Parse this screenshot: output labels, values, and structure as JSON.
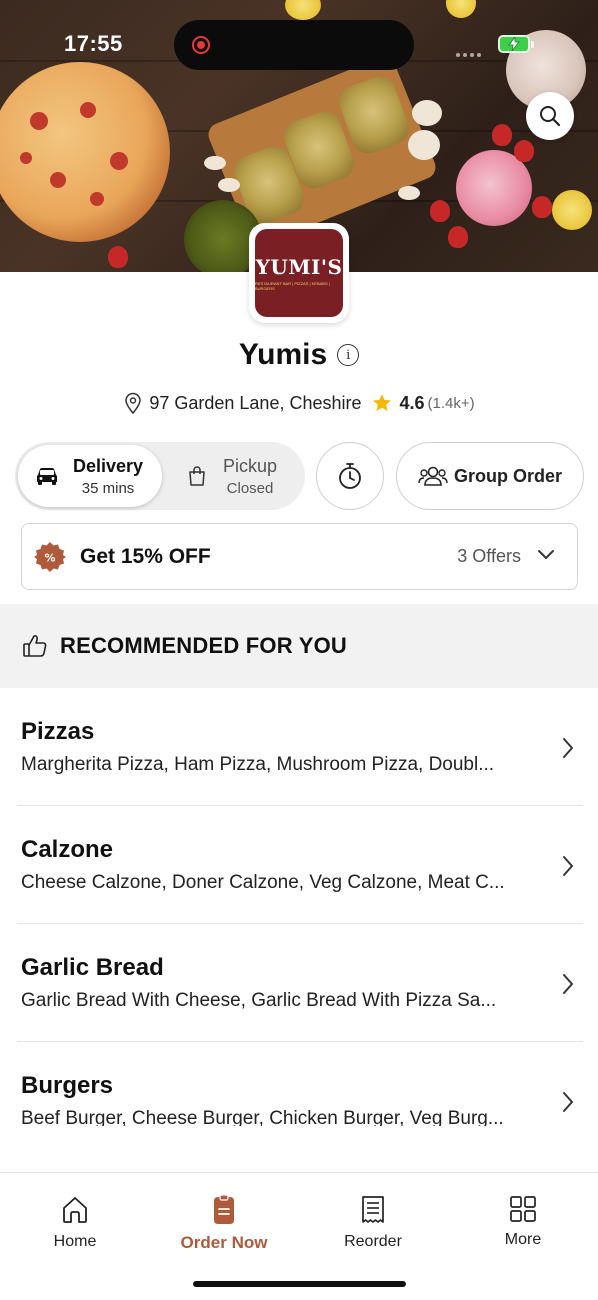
{
  "status_bar": {
    "time": "17:55"
  },
  "restaurant": {
    "logo_text": "YUMI'S",
    "logo_subtext": "RESTAURANT BAR | PIZZAS | KEBABS | BURGERS",
    "name": "Yumis",
    "address": "97 Garden Lane, Cheshire",
    "rating": "4.6",
    "rating_count": "(1.4k+)"
  },
  "order_mode": {
    "delivery": {
      "label": "Delivery",
      "sub": "35 mins",
      "selected": true
    },
    "pickup": {
      "label": "Pickup",
      "sub": "Closed",
      "selected": false
    },
    "group_order_label": "Group Order"
  },
  "offers": {
    "title": "Get 15% OFF",
    "count_label": "3 Offers",
    "badge_symbol": "%"
  },
  "recommended": {
    "title": "RECOMMENDED FOR YOU"
  },
  "categories": [
    {
      "name": "Pizzas",
      "items": "Margherita Pizza, Ham Pizza, Mushroom Pizza, Doubl..."
    },
    {
      "name": "Calzone",
      "items": "Cheese Calzone, Doner Calzone, Veg Calzone, Meat C..."
    },
    {
      "name": "Garlic Bread",
      "items": "Garlic Bread With Cheese, Garlic Bread With Pizza Sa..."
    },
    {
      "name": "Burgers",
      "items": "Beef Burger, Cheese Burger, Chicken Burger, Veg Burg..."
    }
  ],
  "bottom_nav": [
    {
      "label": "Home",
      "icon": "home-icon",
      "active": false
    },
    {
      "label": "Order Now",
      "icon": "order-icon",
      "active": true
    },
    {
      "label": "Reorder",
      "icon": "receipt-icon",
      "active": false
    },
    {
      "label": "More",
      "icon": "grid-icon",
      "active": false
    }
  ],
  "colors": {
    "accent": "#b05a3c",
    "star": "#f5b800",
    "logo_bg": "#7a1f24"
  }
}
